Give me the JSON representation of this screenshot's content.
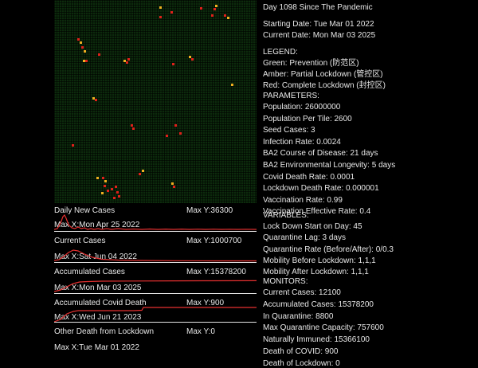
{
  "header": {
    "day": "Day 1098 Since The Pandemic",
    "starting_date": "Starting Date: Tue Mar 01 2022",
    "current_date": "Current Date: Mon Mar 03 2025"
  },
  "legend": {
    "title": "LEGEND:",
    "green": "Green: Prevention (防范区)",
    "amber": "Amber: Partial Lockdown (管控区)",
    "red": "Red: Complete Lockdown (封控区)"
  },
  "parameters": {
    "title": "PARAMETERS:",
    "items": [
      "Population: 26000000",
      "Population Per Tile: 2600",
      "Seed Cases: 3",
      "Infection Rate: 0.0024",
      "BA2 Course of Disease: 21 days",
      "BA2 Environmental Longevity: 5 days",
      "Covid Death Rate: 0.0001",
      "Lockdown Death Rate: 0.000001",
      "Vaccination Rate: 0.99",
      "Vaccination Effective Rate: 0.4"
    ]
  },
  "variables": {
    "title": "VARIABLES:",
    "items": [
      "Lock Down Start on Day: 45",
      "Quarantine Lag: 3 days",
      "Quarantine Rate (Before/After): 0/0.3",
      "Mobility Before Lockdown: 1,1,1",
      "Mobility After Lockdown: 1,1,1"
    ]
  },
  "monitors": {
    "title": "MONITORS:",
    "items": [
      "Current Cases: 12100",
      "Accumulated Cases: 15378200",
      "In Quarantine: 8800",
      "Max Quarantine Capacity: 757600",
      "Naturally Immuned: 15366100",
      "Death of COVID: 900",
      "Death of Lockdown: 0"
    ]
  },
  "colors": {
    "grid_green": "#0c2a0c",
    "cell_red": "#e0201a",
    "cell_amber": "#f0b020",
    "series_red": "#e53030"
  },
  "charts": [
    {
      "title": "Daily New Cases",
      "max_y": "Max Y:36300",
      "max_x": "Max X:Mon Apr 25 2022"
    },
    {
      "title": "Current Cases",
      "max_y": "Max Y:1000700",
      "max_x": "Max X:Sat Jun 04 2022"
    },
    {
      "title": "Accumulated Cases",
      "max_y": "Max Y:15378200",
      "max_x": "Max X:Mon Mar 03 2025"
    },
    {
      "title": "Accumulated Covid Death",
      "max_y": "Max Y:900",
      "max_x": "Max X:Wed Jun 21 2023"
    },
    {
      "title": "Other Death from Lockdown",
      "max_y": "Max Y:0",
      "max_x": "Max X:Tue Mar 01 2022"
    }
  ]
}
